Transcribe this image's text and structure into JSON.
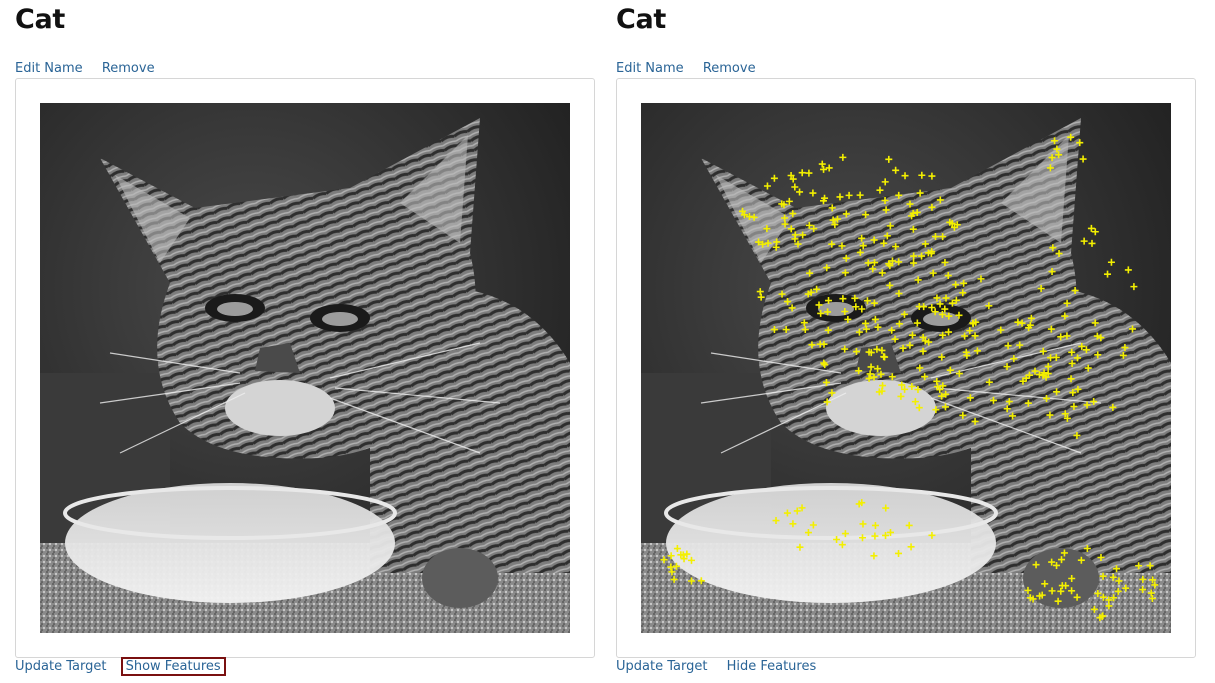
{
  "colors": {
    "link": "#2a6496",
    "focus_outline": "#7a1010",
    "feature_marker": "#f3ef00",
    "frame_border": "#d6d6d6"
  },
  "panels": [
    {
      "title": "Cat",
      "edit_label": "Edit Name",
      "remove_label": "Remove",
      "update_label": "Update Target",
      "features_toggle_label": "Show Features",
      "features_visible": false
    },
    {
      "title": "Cat",
      "edit_label": "Edit Name",
      "remove_label": "Remove",
      "update_label": "Update Target",
      "features_toggle_label": "Hide Features",
      "features_visible": true
    }
  ]
}
